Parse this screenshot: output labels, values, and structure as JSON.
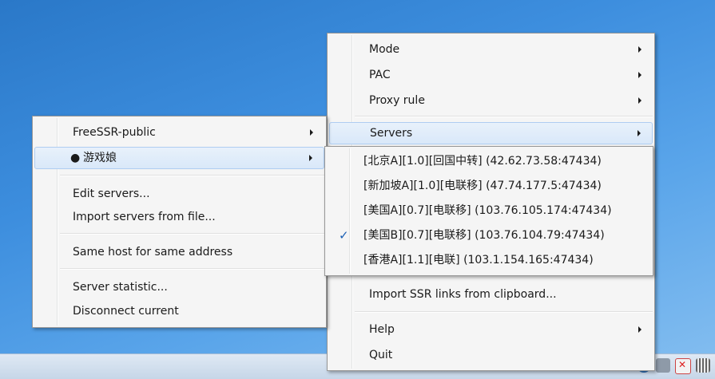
{
  "main_menu": {
    "items": [
      {
        "label": "Mode",
        "has_submenu": true
      },
      {
        "label": "PAC",
        "has_submenu": true
      },
      {
        "label": "Proxy rule",
        "has_submenu": true
      },
      {
        "label": "Servers",
        "has_submenu": true,
        "highlighted": true
      },
      {
        "label": "Import SSR links from clipboard...",
        "has_submenu": false
      },
      {
        "label": "Help",
        "has_submenu": true
      },
      {
        "label": "Quit",
        "has_submenu": false
      }
    ]
  },
  "servers_menu": {
    "groups": [
      {
        "label": "FreeSSR-public",
        "has_submenu": true
      },
      {
        "label": "游戏娘",
        "has_submenu": true,
        "bullet": "●",
        "highlighted": true
      }
    ],
    "actions": [
      {
        "label": "Edit servers..."
      },
      {
        "label": "Import servers from file..."
      },
      {
        "label": "Same host for same address"
      },
      {
        "label": "Server statistic..."
      },
      {
        "label": "Disconnect current"
      }
    ]
  },
  "server_list": {
    "check_glyph": "✓",
    "items": [
      {
        "label": "[北京A][1.0][回国中转] (42.62.73.58:47434)",
        "checked": false
      },
      {
        "label": "[新加坡A][1.0][电联移] (47.74.177.5:47434)",
        "checked": false
      },
      {
        "label": "[美国A][0.7][电联移] (103.76.105.174:47434)",
        "checked": false
      },
      {
        "label": "[美国B][0.7][电联移] (103.76.104.79:47434)",
        "checked": true
      },
      {
        "label": "[香港A][1.1][电联] (103.1.154.165:47434)",
        "checked": false
      }
    ]
  }
}
